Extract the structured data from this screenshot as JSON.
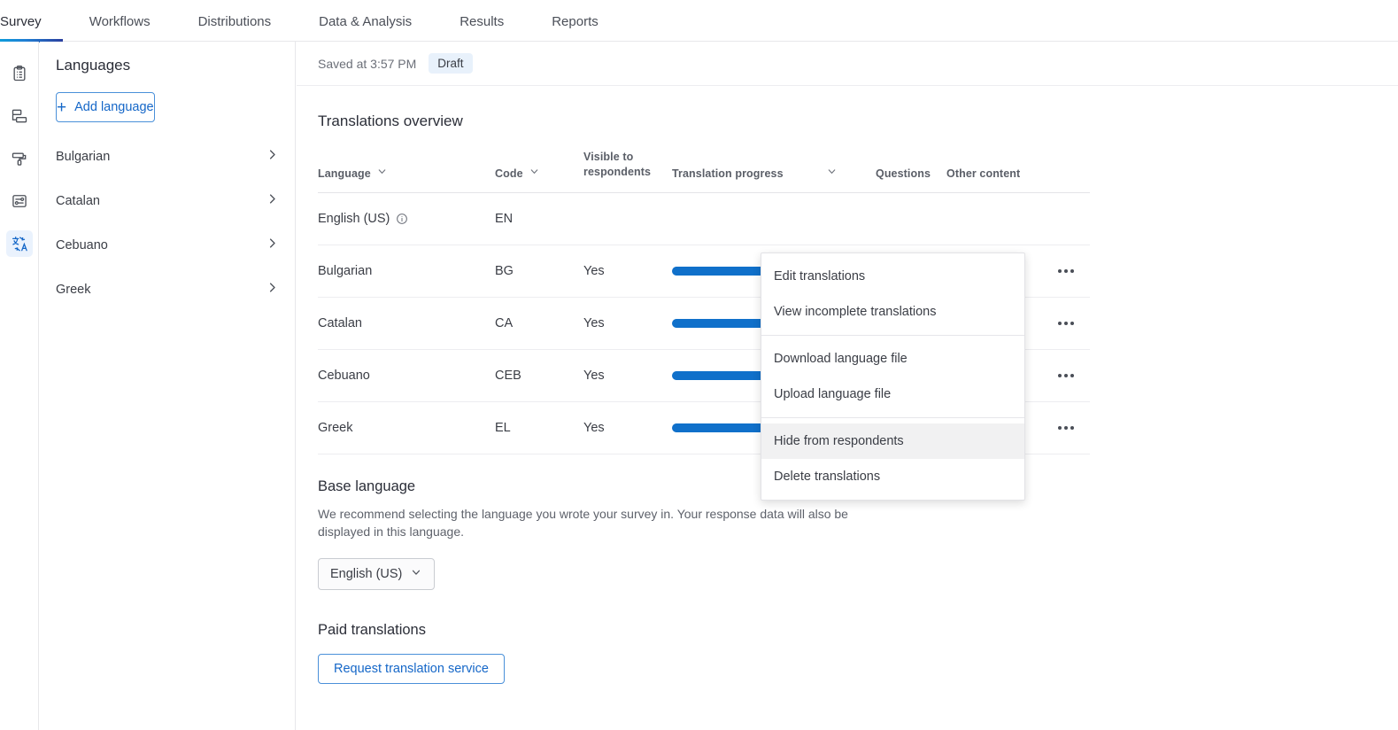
{
  "topnav": {
    "tabs": [
      {
        "label": "Survey",
        "active": true
      },
      {
        "label": "Workflows",
        "active": false
      },
      {
        "label": "Distributions",
        "active": false
      },
      {
        "label": "Data & Analysis",
        "active": false
      },
      {
        "label": "Results",
        "active": false
      },
      {
        "label": "Reports",
        "active": false
      }
    ]
  },
  "rail": {
    "items": [
      {
        "icon": "clipboard-icon",
        "active": false
      },
      {
        "icon": "flow-blocks-icon",
        "active": false
      },
      {
        "icon": "paint-roller-icon",
        "active": false
      },
      {
        "icon": "sliders-settings-icon",
        "active": false
      },
      {
        "icon": "translate-icon",
        "active": true
      }
    ]
  },
  "languages_panel": {
    "title": "Languages",
    "add_button": "Add language",
    "items": [
      {
        "label": "Bulgarian"
      },
      {
        "label": "Catalan"
      },
      {
        "label": "Cebuano"
      },
      {
        "label": "Greek"
      }
    ]
  },
  "status": {
    "saved_text": "Saved at 3:57 PM",
    "badge": "Draft"
  },
  "overview": {
    "title": "Translations overview",
    "columns": [
      {
        "label": "Language",
        "sortable": true
      },
      {
        "label": "Code",
        "sortable": true
      },
      {
        "label": "Visible to respondents",
        "sortable": false
      },
      {
        "label": "Translation progress",
        "sortable": true
      },
      {
        "label": "Questions",
        "sortable": false
      },
      {
        "label": "Other content",
        "sortable": false
      }
    ],
    "rows": [
      {
        "language": "English (US)",
        "info": true,
        "code": "EN",
        "visible": "",
        "progress": null,
        "questions": "",
        "other_content": ""
      },
      {
        "language": "Bulgarian",
        "info": false,
        "code": "BG",
        "visible": "Yes",
        "progress": 100,
        "questions": "",
        "other_content": ""
      },
      {
        "language": "Catalan",
        "info": false,
        "code": "CA",
        "visible": "Yes",
        "progress": 100,
        "questions": "",
        "other_content": ""
      },
      {
        "language": "Cebuano",
        "info": false,
        "code": "CEB",
        "visible": "Yes",
        "progress": 100,
        "questions": "",
        "other_content": ""
      },
      {
        "language": "Greek",
        "info": false,
        "code": "EL",
        "visible": "Yes",
        "progress": 100,
        "questions": "",
        "other_content": ""
      }
    ]
  },
  "context_menu": {
    "items": [
      {
        "label": "Edit translations",
        "highlighted": false,
        "separator_after": false
      },
      {
        "label": "View incomplete translations",
        "highlighted": false,
        "separator_after": true
      },
      {
        "label": "Download language file",
        "highlighted": false,
        "separator_after": false
      },
      {
        "label": "Upload language file",
        "highlighted": false,
        "separator_after": true
      },
      {
        "label": "Hide from respondents",
        "highlighted": true,
        "separator_after": false
      },
      {
        "label": "Delete translations",
        "highlighted": false,
        "separator_after": false
      }
    ]
  },
  "base_language": {
    "title": "Base language",
    "description": "We recommend selecting the language you wrote your survey in. Your response data will also be displayed in this language.",
    "selected": "English (US)"
  },
  "paid_translations": {
    "title": "Paid translations",
    "button": "Request translation service"
  },
  "colors": {
    "accent_blue": "#1070ca",
    "link_blue": "#1567c8",
    "badge_bg": "#e8f1fb",
    "progress_track": "#e2e4e8"
  }
}
